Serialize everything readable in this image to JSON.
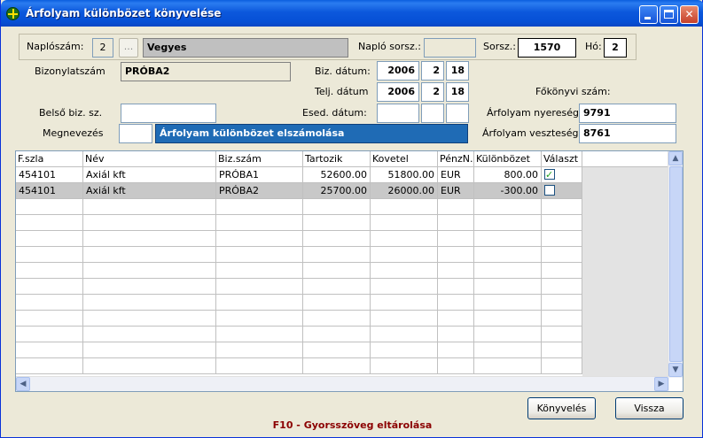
{
  "window": {
    "title": "Árfolyam különbözet könyvelése"
  },
  "header": {
    "naploszam_label": "Naplószám:",
    "naploszam_value": "2",
    "dots_label": "...",
    "naplo_name": "Vegyes",
    "naplo_sorsz_label": "Napló sorsz.:",
    "naplo_sorsz_value": "",
    "sorsz_label": "Sorsz.:",
    "sorsz_value": "1570",
    "ho_label": "Hó:",
    "ho_value": "2"
  },
  "form": {
    "bizonylatszam_label": "Bizonylatszám",
    "bizonylatszam_value": "PRÓBA2",
    "biz_datum_label": "Biz. dátum:",
    "biz_datum": {
      "year": "2006",
      "month": "2",
      "day": "18"
    },
    "telj_datum_label": "Telj. dátum",
    "telj_datum": {
      "year": "2006",
      "month": "2",
      "day": "18"
    },
    "esed_datum_label": "Esed. dátum:",
    "esed_datum": {
      "year": "",
      "month": "",
      "day": ""
    },
    "belso_label": "Belső biz. sz.",
    "belso_value": "",
    "megnevezes_label": "Megnevezés",
    "megnevezes_code": "",
    "megnevezes_value": "Árfolyam különbözet elszámolása",
    "fokonyvi_label": "Főkönyvi szám:",
    "nyereseg_label": "Árfolyam nyereség",
    "nyereseg_value": "9791",
    "veszteseg_label": "Árfolyam veszteség",
    "veszteseg_value": "8761"
  },
  "grid": {
    "columns": [
      "F.szla",
      "Név",
      "Biz.szám",
      "Tartozik",
      "Kovetel",
      "PénzN.",
      "Különbözet",
      "Választ"
    ],
    "rows": [
      {
        "fszla": "454101",
        "nev": "Axiál kft",
        "bizszam": "PRÓBA1",
        "tartozik": "52600.00",
        "kovetel": "51800.00",
        "penzn": "EUR",
        "kulonbozet": "800.00",
        "valaszt": true
      },
      {
        "fszla": "454101",
        "nev": "Axiál kft",
        "bizszam": "PRÓBA2",
        "tartozik": "25700.00",
        "kovetel": "26000.00",
        "penzn": "EUR",
        "kulonbozet": "-300.00",
        "valaszt": false
      }
    ],
    "selected_row": 1
  },
  "buttons": {
    "konyveles": "Könyvelés",
    "vissza": "Vissza"
  },
  "status": "F10 - Gyorsszöveg eltárolása"
}
